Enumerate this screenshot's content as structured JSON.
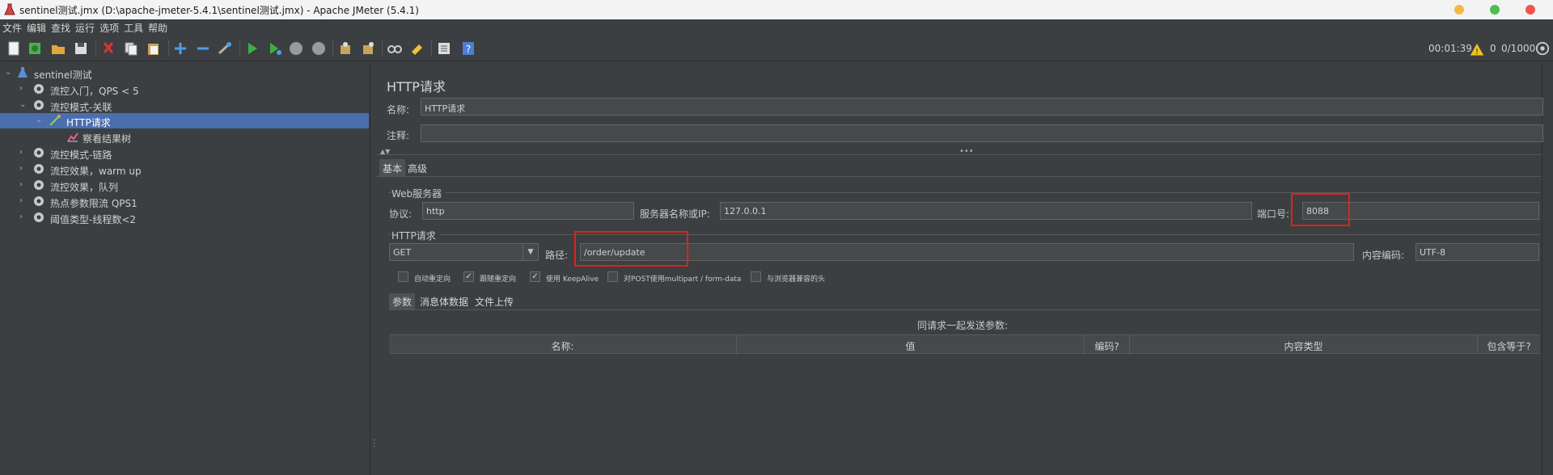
{
  "window": {
    "title": "sentinel测试.jmx (D:\\apache-jmeter-5.4.1\\sentinel测试.jmx) - Apache JMeter (5.4.1)"
  },
  "menu": [
    "文件",
    "编辑",
    "查找",
    "运行",
    "选项",
    "工具",
    "帮助"
  ],
  "toolbar": {
    "status_time": "00:01:39",
    "warning_count": "0",
    "threads": "0/1000",
    "icons": [
      "new-icon",
      "templates-icon",
      "open-icon",
      "save-icon",
      "cut-icon",
      "copy-icon",
      "paste-icon",
      "expand-icon",
      "collapse-icon",
      "toggle-icon",
      "start-icon",
      "start-no-pause-icon",
      "stop-icon",
      "shutdown-icon",
      "clear-icon",
      "clear-all-icon",
      "search-icon",
      "reset-search-icon",
      "function-helper-icon",
      "help-icon"
    ]
  },
  "tree": {
    "root": "sentinel测试",
    "items": [
      {
        "label": "流控入门，QPS < 5",
        "level": 1,
        "expanded": false
      },
      {
        "label": "流控模式-关联",
        "level": 1,
        "expanded": true
      },
      {
        "label": "HTTP请求",
        "level": 2,
        "expanded": true,
        "selected": true
      },
      {
        "label": "察看结果树",
        "level": 3
      },
      {
        "label": "流控模式-链路",
        "level": 1,
        "expanded": false
      },
      {
        "label": "流控效果，warm up",
        "level": 1,
        "expanded": false
      },
      {
        "label": "流控效果，队列",
        "level": 1,
        "expanded": false
      },
      {
        "label": "热点参数限流 QPS1",
        "level": 1,
        "expanded": false
      },
      {
        "label": "阈值类型-线程数<2",
        "level": 1,
        "expanded": false
      }
    ]
  },
  "panel": {
    "title": "HTTP请求",
    "name_label": "名称:",
    "name_value": "HTTP请求",
    "comment_label": "注释:",
    "comment_value": "",
    "tabs": [
      "基本",
      "高级"
    ],
    "web_server": {
      "group_title": "Web服务器",
      "protocol_label": "协议:",
      "protocol_value": "http",
      "server_label": "服务器名称或IP:",
      "server_value": "127.0.0.1",
      "port_label": "端口号:",
      "port_value": "8088"
    },
    "http_request": {
      "group_title": "HTTP请求",
      "method": "GET",
      "path_label": "路径:",
      "path_value": "/order/update",
      "encoding_label": "内容编码:",
      "encoding_value": "UTF-8"
    },
    "checkboxes": [
      {
        "label": "自动重定向",
        "checked": false
      },
      {
        "label": "跟随重定向",
        "checked": true
      },
      {
        "label": "使用 KeepAlive",
        "checked": true
      },
      {
        "label": "对POST使用multipart / form-data",
        "checked": false
      },
      {
        "label": "与浏览器兼容的头",
        "checked": false
      }
    ],
    "sub_tabs": [
      "参数",
      "消息体数据",
      "文件上传"
    ],
    "params_caption": "同请求一起发送参数:",
    "columns": [
      "名称:",
      "值",
      "编码?",
      "内容类型",
      "包含等于?"
    ]
  },
  "colors": {
    "background": "#3c3f41",
    "selection": "#4b6eaf",
    "highlight": "#e02020"
  }
}
